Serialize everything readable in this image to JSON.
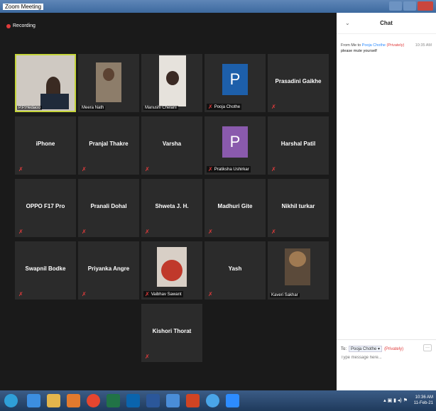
{
  "window": {
    "title": "Zoom Meeting"
  },
  "recording": {
    "label": "Recording"
  },
  "participants": [
    {
      "name": "P.P.Hedaoo",
      "center": ""
    },
    {
      "name": "Meera Nath",
      "center": ""
    },
    {
      "name": "Manushi Chelani",
      "center": ""
    },
    {
      "name": "Pooja Chothe",
      "center": "P"
    },
    {
      "name": "",
      "center": "Prasadini Gaikhe"
    },
    {
      "name": "",
      "center": "iPhone"
    },
    {
      "name": "",
      "center": "Pranjal Thakre"
    },
    {
      "name": "",
      "center": "Varsha"
    },
    {
      "name": "Pratiksha Ushirkar",
      "center": "P"
    },
    {
      "name": "",
      "center": "Harshal Patil"
    },
    {
      "name": "",
      "center": "OPPO F17 Pro"
    },
    {
      "name": "",
      "center": "Pranali Dohal"
    },
    {
      "name": "",
      "center": "Shweta J. H."
    },
    {
      "name": "",
      "center": "Madhuri Gite"
    },
    {
      "name": "",
      "center": "Nikhil turkar"
    },
    {
      "name": "",
      "center": "Swapnil Bodke"
    },
    {
      "name": "",
      "center": "Priyanka Angre"
    },
    {
      "name": "Vaibhav Sawant",
      "center": ""
    },
    {
      "name": "",
      "center": "Yash"
    },
    {
      "name": "Kaveri Sakhar",
      "center": ""
    },
    {
      "name": "",
      "center": "Kishori Thorat"
    }
  ],
  "chat": {
    "title": "Chat",
    "message": {
      "from_prefix": "From Me to",
      "to": "Pooja Chothe",
      "privacy": "(Privately)",
      "time": "10:35 AM",
      "text": "please mute yourself"
    },
    "footer": {
      "to_label": "To:",
      "to_value": "Pooja Chothe ▾",
      "privacy": "(Privately)",
      "more": "···",
      "placeholder": "Type message here..."
    }
  },
  "taskbar": {
    "time": "10:36 AM",
    "date": "11-Feb-21"
  },
  "colors": {
    "active_speaker": "#c4d43a",
    "mute_red": "#e03b3b",
    "avatar_blue": "#1d5faa",
    "avatar_purple": "#8a5aad",
    "link_blue": "#2d8cff"
  }
}
